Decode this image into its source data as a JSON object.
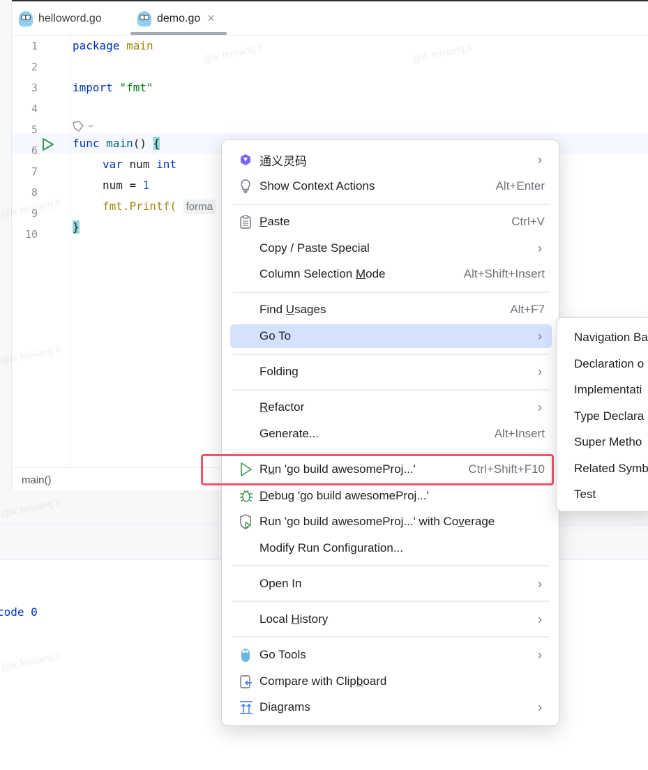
{
  "tabs": [
    {
      "label": "helloword.go",
      "active": false
    },
    {
      "label": "demo.go",
      "active": true,
      "close": "×"
    }
  ],
  "editor": {
    "line_numbers": [
      "1",
      "2",
      "3",
      "4",
      "5",
      "6",
      "7",
      "8",
      "9",
      "10"
    ],
    "code": {
      "l1a": "package",
      "l1b": "main",
      "l3a": "import",
      "l3b": "\"fmt\"",
      "l5a": "func",
      "l5b": "main",
      "l5c": "()",
      "l5d": "{",
      "l6a": "var",
      "l6b": "num",
      "l6c": "int",
      "l7a": "num = ",
      "l7b": "1",
      "l8a": "fmt.Printf(",
      "l8hint": "forma",
      "l9": "}"
    },
    "breadcrumb": "main()"
  },
  "console": {
    "text": "code 0"
  },
  "watermark": "@lk feixiang.li",
  "context_menu": {
    "items": [
      {
        "label": "通义灵码",
        "icon": "tongyi-icon",
        "submenu": true
      },
      {
        "label": "Show Context Actions",
        "shortcut": "Alt+Enter",
        "icon": "lightbulb-icon"
      },
      {
        "label": "Paste",
        "shortcut": "Ctrl+V",
        "icon": "clipboard-icon"
      },
      {
        "label": "Copy / Paste Special",
        "submenu": true
      },
      {
        "label": "Column Selection Mode",
        "shortcut": "Alt+Shift+Insert"
      },
      {
        "label": "Find Usages",
        "shortcut": "Alt+F7"
      },
      {
        "label": "Go To",
        "submenu": true,
        "highlighted": true
      },
      {
        "label": "Folding",
        "submenu": true
      },
      {
        "label": "Refactor",
        "submenu": true
      },
      {
        "label": "Generate...",
        "shortcut": "Alt+Insert"
      },
      {
        "label": "Run 'go build awesomeProj...'",
        "shortcut": "Ctrl+Shift+F10",
        "icon": "run-icon",
        "annotated": true
      },
      {
        "label": "Debug 'go build awesomeProj...'",
        "icon": "debug-icon"
      },
      {
        "label": "Run 'go build awesomeProj...' with Coverage",
        "icon": "coverage-icon"
      },
      {
        "label": "Modify Run Configuration..."
      },
      {
        "label": "Open In",
        "submenu": true
      },
      {
        "label": "Local History",
        "submenu": true
      },
      {
        "label": "Go Tools",
        "submenu": true,
        "icon": "gopher-icon"
      },
      {
        "label": "Compare with Clipboard",
        "icon": "compare-clipboard-icon"
      },
      {
        "label": "Diagrams",
        "submenu": true,
        "icon": "diagrams-icon"
      }
    ]
  },
  "goto_submenu": {
    "items": [
      "Navigation Ba",
      "Declaration o",
      "Implementati",
      "Type Declara",
      "Super Metho",
      "Related Symb",
      "Test"
    ]
  },
  "colors": {
    "highlight": "#d4e2ff",
    "annotation": "#f25368",
    "run_green": "#369650"
  }
}
